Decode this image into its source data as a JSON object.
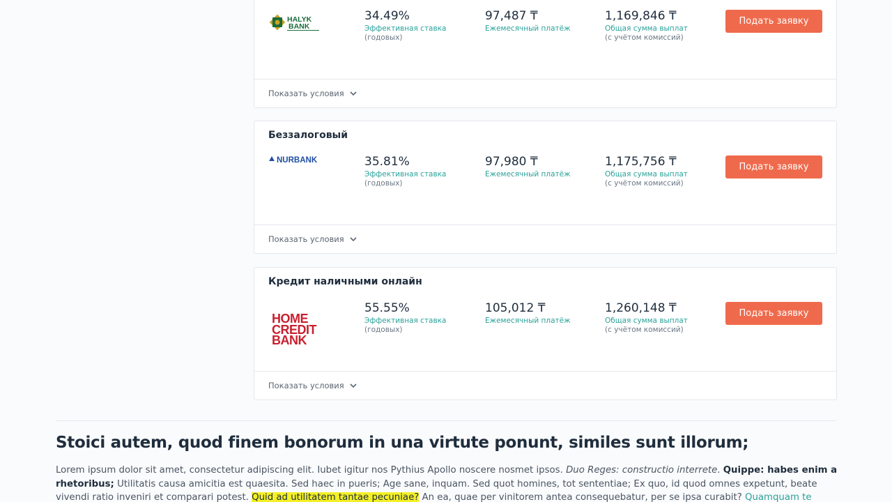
{
  "offers": [
    {
      "category": "",
      "bank": "HALYK BANK",
      "rate": "34.49%",
      "rate_label": "Эффективная ставка",
      "rate_sub": "(годовых)",
      "monthly": "97,487 ₸",
      "monthly_label": "Ежемесячный платёж",
      "total": "1,169,846 ₸",
      "total_label": "Общая сумма выплат",
      "total_sub": "(с учётом комиссий)",
      "apply_label": "Подать заявку",
      "conditions_label": "Показать условия"
    },
    {
      "category": "Беззалоговый",
      "bank": "NURBANK",
      "rate": "35.81%",
      "rate_label": "Эффективная ставка",
      "rate_sub": "(годовых)",
      "monthly": "97,980 ₸",
      "monthly_label": "Ежемесячный платёж",
      "total": "1,175,756 ₸",
      "total_label": "Общая сумма выплат",
      "total_sub": "(с учётом комиссий)",
      "apply_label": "Подать заявку",
      "conditions_label": "Показать условия"
    },
    {
      "category": "Кредит наличными онлайн",
      "bank": "HOME CREDIT BANK",
      "bank_lines": [
        "HOME",
        "CREDIT",
        "BANK"
      ],
      "rate": "55.55%",
      "rate_label": "Эффективная ставка",
      "rate_sub": "(годовых)",
      "monthly": "105,012 ₸",
      "monthly_label": "Ежемесячный платёж",
      "total": "1,260,148 ₸",
      "total_label": "Общая сумма выплат",
      "total_sub": "(с учётом комиссий)",
      "apply_label": "Подать заявку",
      "conditions_label": "Показать условия"
    }
  ],
  "article": {
    "title": "Stoici autem, quod finem bonorum in una virtute ponunt, similes sunt illorum;",
    "p1_text1": "Lorem ipsum dolor sit amet, consectetur adipiscing elit. Iubet igitur nos Pythius Apollo noscere nosmet ipsos. ",
    "p1_em": "Duo Reges: constructio interrete",
    "p1_text2": ". ",
    "p1_bold": "Quippe: habes enim a rhetoribus;",
    "p1_text3": " Utilitatis causa amicitia est quaesita. Sed haec in pueris; Age sane, inquam. Sed quot homines, tot sententiae; Ex quo, id quod omnes expetunt, beate vivendi ratio inveniri et comparari potest. ",
    "p1_highlight": "Quid ad utilitatem tantae pecuniae?",
    "p1_text4": " An ea, quae per vinitorem antea consequebatur, per se ipsa curabit? ",
    "p1_link": "Quamquam te quidem video minime esse deterritum."
  },
  "colors": {
    "accent": "#ef6a4c",
    "teal": "#2aa29a",
    "halyk_green": "#1b6b3a",
    "nurbank_blue": "#1f4ea1",
    "homecredit_red": "#c8202f",
    "highlight": "#f4f026"
  },
  "icons": {
    "chevron": "chevron-down-icon"
  }
}
